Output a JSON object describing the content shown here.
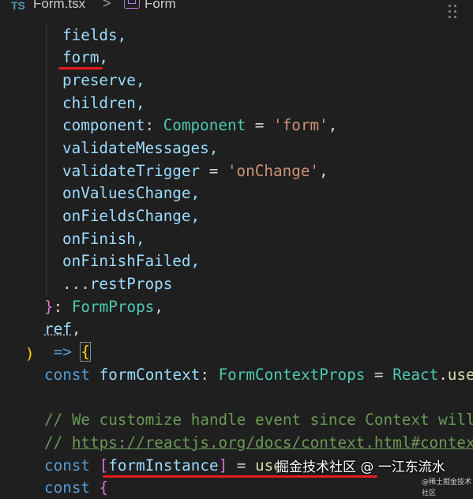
{
  "breadcrumb": {
    "lang_badge": "TS",
    "file": "Form.tsx",
    "separator": ">",
    "symbol_icon": "symbol-field-icon",
    "symbol": "Form"
  },
  "code": {
    "lines": [
      {
        "text": "fields,"
      },
      {
        "text": "form,"
      },
      {
        "text": "preserve,"
      },
      {
        "text": "children,"
      },
      {
        "prop": "component",
        "colon": ": ",
        "type": "Component",
        "eq": " = ",
        "str": "'form'",
        "end": ","
      },
      {
        "text": "validateMessages,"
      },
      {
        "prop": "validateTrigger",
        "eq": " = ",
        "str": "'onChange'",
        "end": ","
      },
      {
        "text": "onValuesChange,"
      },
      {
        "text": "onFieldsChange,"
      },
      {
        "text": "onFinish,"
      },
      {
        "text": "onFinishFailed,"
      },
      {
        "spread": "...",
        "text": "restProps"
      },
      {
        "brace": "}",
        "colon": ": ",
        "type": "FormProps",
        "end": ","
      },
      {
        "text": "ref",
        "end": ","
      },
      {
        "paren": ")",
        "arrow": " => ",
        "brace": "{"
      },
      {
        "kw": "const",
        "var": " formContext",
        "colon": ": ",
        "type": "FormContextProps",
        "eq": " = ",
        "obj": "React",
        "dot": ".",
        "fn": "use"
      },
      {
        "text": ""
      },
      {
        "comment": "// We customize handle event since Context will"
      },
      {
        "comment_prefix": "// ",
        "link": "https://reactjs.org/docs/context.html#contex"
      },
      {
        "kw": "const",
        "sp": " ",
        "bracket_open": "[",
        "var": "formInstance",
        "bracket_close": "]",
        "eq": " = ",
        "fn": "use"
      },
      {
        "kw": "const",
        "sp": " ",
        "brace": "{"
      }
    ]
  },
  "watermark": {
    "main": "掘金技术社区 @ 一江东流水",
    "small": "@稀土掘金技术社区"
  },
  "colors": {
    "background": "#1f1f1f",
    "variable": "#9cdcfe",
    "keyword": "#569cd6",
    "type": "#4ec9b0",
    "string": "#ce9178",
    "comment": "#6a9955",
    "annotation_underline": "#e81c1c"
  }
}
